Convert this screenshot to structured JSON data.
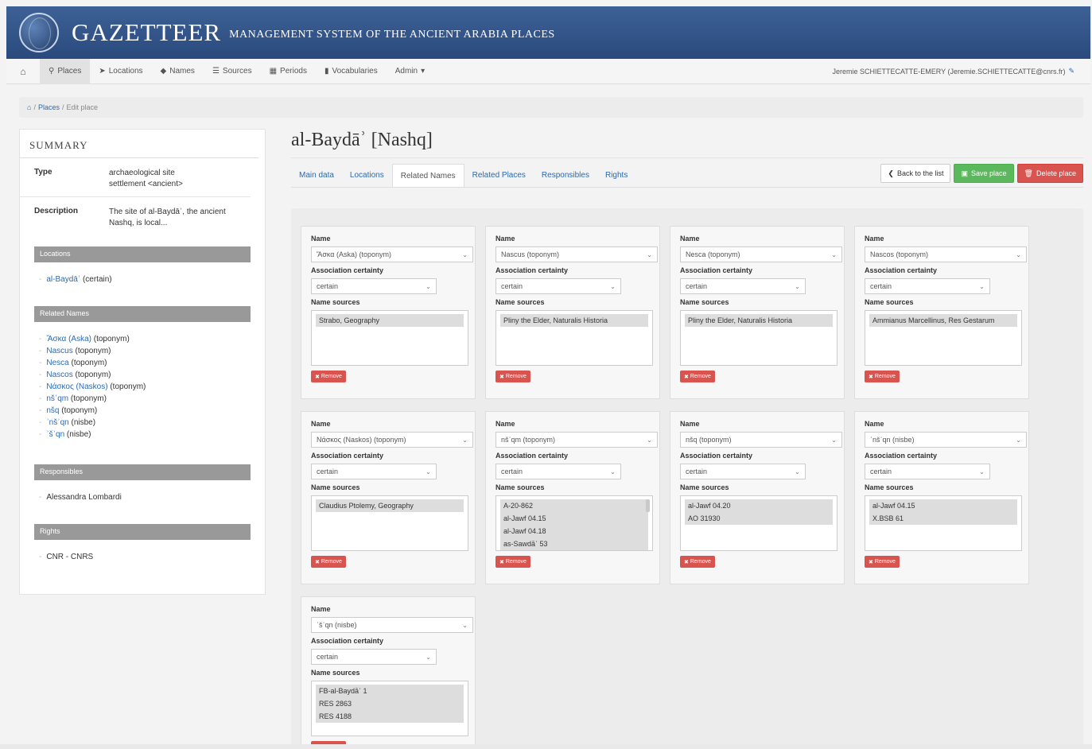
{
  "header": {
    "brand": "GAZETTEER",
    "tagline": "MANAGEMENT SYSTEM OF THE ANCIENT ARABIA PLACES"
  },
  "navbar": {
    "items": [
      {
        "icon": "marker-icon",
        "label": "Places",
        "active": true
      },
      {
        "icon": "location-arrow-icon",
        "label": "Locations"
      },
      {
        "icon": "tag-icon",
        "label": "Names"
      },
      {
        "icon": "list-icon",
        "label": "Sources"
      },
      {
        "icon": "calendar-icon",
        "label": "Periods"
      },
      {
        "icon": "book-icon",
        "label": "Vocabularies"
      },
      {
        "icon": "caret-icon",
        "label": "Admin"
      }
    ],
    "user": "Jeremie SCHIETTECATTE-EMERY (Jeremie.SCHIETTECATTE@cnrs.fr)"
  },
  "breadcrumb": {
    "places": "Places",
    "current": "Edit place"
  },
  "sidebar": {
    "title": "SUMMARY",
    "type_label": "Type",
    "type_value_1": "archaeological site",
    "type_value_2": "settlement <ancient>",
    "desc_label": "Description",
    "desc_value": "The site of al-Baydāʾ, the ancient Nashq, is local...",
    "locations_header": "Locations",
    "location_name": "al-Baydāʾ",
    "location_certainty": "(certain)",
    "related_header": "Related Names",
    "related_names": [
      {
        "name": "Ἄσκα (Aska)",
        "kind": "(toponym)"
      },
      {
        "name": "Nascus",
        "kind": "(toponym)"
      },
      {
        "name": "Nesca",
        "kind": "(toponym)"
      },
      {
        "name": "Nascos",
        "kind": "(toponym)"
      },
      {
        "name": "Νάσκος (Naskos)",
        "kind": "(toponym)"
      },
      {
        "name": "nšʾqm",
        "kind": "(toponym)"
      },
      {
        "name": "nšq",
        "kind": "(toponym)"
      },
      {
        "name": "ʾnšʾqn",
        "kind": "(nisbe)"
      },
      {
        "name": "ʾšʾqn",
        "kind": "(nisbe)"
      }
    ],
    "responsibles_header": "Responsibles",
    "responsible": "Alessandra Lombardi",
    "rights_header": "Rights",
    "rights": "CNR - CNRS"
  },
  "main": {
    "title": "al-Baydāʾ [Nashq]",
    "tabs": [
      "Main data",
      "Locations",
      "Related Names",
      "Related Places",
      "Responsibles",
      "Rights"
    ],
    "active_tab": 2,
    "buttons": {
      "back": "Back to the list",
      "save": "Save place",
      "delete": "Delete place"
    },
    "labels": {
      "name": "Name",
      "certainty": "Association certainty",
      "sources": "Name sources",
      "remove": "Remove"
    },
    "cards": [
      {
        "name": "Ἄσκα (Aska) (toponym)",
        "certainty": "certain",
        "sources": [
          "Strabo, Geography"
        ]
      },
      {
        "name": "Nascus (toponym)",
        "certainty": "certain",
        "sources": [
          "Pliny the Elder, Naturalis Historia"
        ]
      },
      {
        "name": "Nesca (toponym)",
        "certainty": "certain",
        "sources": [
          "Pliny the Elder, Naturalis Historia"
        ]
      },
      {
        "name": "Nascos (toponym)",
        "certainty": "certain",
        "sources": [
          "Ammianus Marcellinus, Res Gestarum"
        ]
      },
      {
        "name": "Νάσκος (Naskos) (toponym)",
        "certainty": "certain",
        "sources": [
          "Claudius Ptolemy, Geography"
        ]
      },
      {
        "name": "nšʾqm (toponym)",
        "certainty": "certain",
        "sources": [
          "A-20-862",
          "al-Jawf 04.15",
          "al-Jawf 04.18",
          "as-Sawdāʾ 53"
        ]
      },
      {
        "name": "nšq (toponym)",
        "certainty": "certain",
        "sources": [
          "al-Jawf 04.20",
          "AO 31930"
        ]
      },
      {
        "name": "ʾnšʾqn (nisbe)",
        "certainty": "certain",
        "sources": [
          "al-Jawf 04.15",
          "X.BSB 61"
        ]
      },
      {
        "name": "ʾšʾqn (nisbe)",
        "certainty": "certain",
        "sources": [
          "FB-al-Baydāʾ 1",
          "RES 2863",
          "RES 4188"
        ]
      }
    ]
  }
}
